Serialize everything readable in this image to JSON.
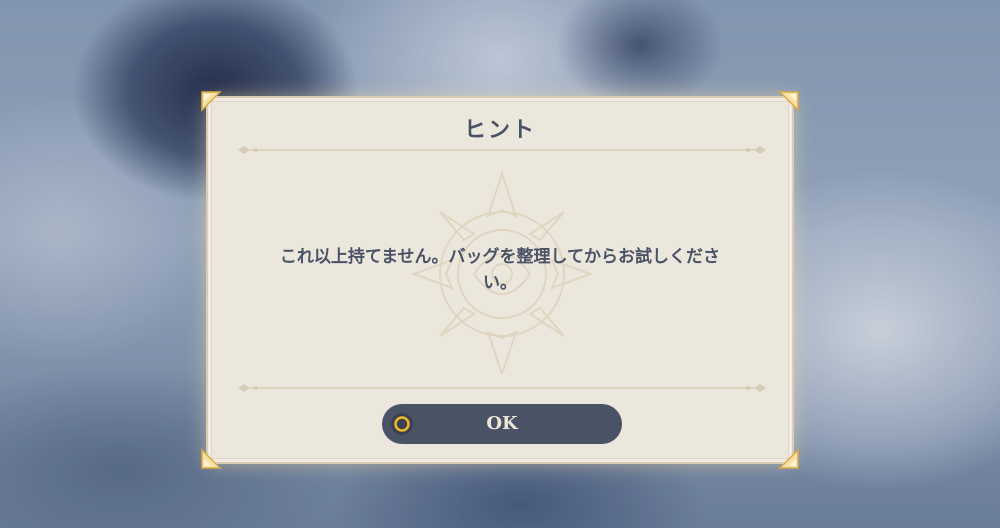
{
  "dialog": {
    "title": "ヒント",
    "message_line1": "これ以上持てません。バッグを整理してからお試しくださ",
    "message_line2": "い。",
    "ok_label": "OK"
  },
  "colors": {
    "panel": "#ece7dd",
    "text": "#4a5366",
    "button": "#4a5366",
    "button_text": "#ece5d8",
    "accent_gold": "#f0b928"
  },
  "icons": {
    "confirm": "circle-ring-icon",
    "corner": "gold-star-corner-icon",
    "emblem": "star-emblem-watermark"
  }
}
